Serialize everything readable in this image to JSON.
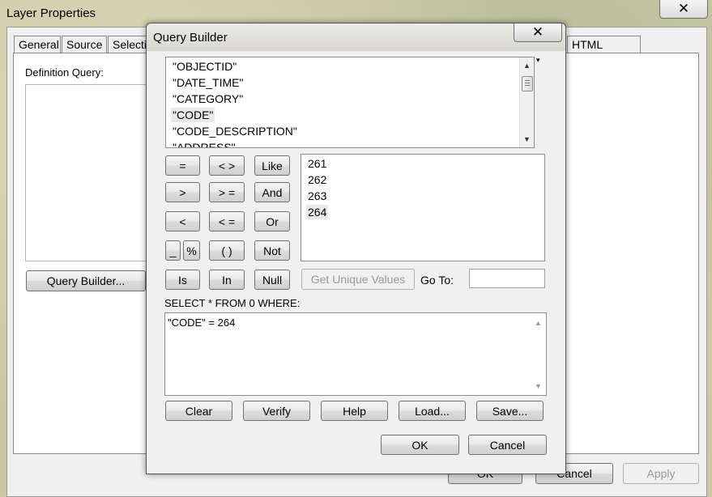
{
  "layer_properties": {
    "title": "Layer Properties",
    "close_glyph": "✕",
    "tabs": [
      {
        "label": "General"
      },
      {
        "label": "Source"
      },
      {
        "label": "Selecti"
      },
      {
        "label": "HTML Popup"
      }
    ],
    "definition_query_label": "Definition Query:",
    "query_builder_button": "Query Builder...",
    "ok_button": "OK",
    "cancel_button": "Cancel",
    "apply_button": "Apply"
  },
  "query_builder": {
    "title": "Query Builder",
    "close_glyph": "✕",
    "fields": [
      "\"OBJECTID\"",
      "\"DATE_TIME\"",
      "\"CATEGORY\"",
      "\"CODE\"",
      "\"CODE_DESCRIPTION\"",
      "\"ADDRESS\""
    ],
    "selected_field": "\"CODE\"",
    "operators": {
      "eq": "=",
      "ne": "< >",
      "like": "Like",
      "gt": ">",
      "ge": "> =",
      "and": "And",
      "lt": "<",
      "le": "< =",
      "or": "Or",
      "underscore": "_",
      "percent": "%",
      "parens": "( )",
      "not": "Not",
      "is": "Is",
      "in": "In",
      "null": "Null"
    },
    "unique_values": [
      "261",
      "262",
      "263",
      "264"
    ],
    "selected_value": "264",
    "get_unique_values_button": "Get Unique Values",
    "goto_label": "Go To:",
    "goto_value": "",
    "sql_prefix": "SELECT * FROM 0 WHERE:",
    "sql_expression": "\"CODE\" = 264",
    "buttons": {
      "clear": "Clear",
      "verify": "Verify",
      "help": "Help",
      "load": "Load...",
      "save": "Save...",
      "ok": "OK",
      "cancel": "Cancel"
    }
  }
}
